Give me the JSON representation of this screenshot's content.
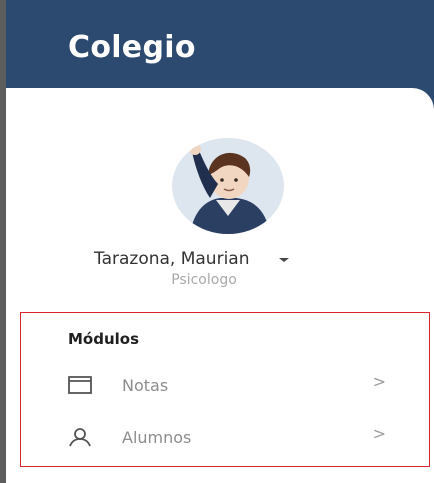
{
  "header": {
    "title": "Colegio"
  },
  "user": {
    "name": "Tarazona, Maurian",
    "role": "Psicologo"
  },
  "modules": {
    "title": "Módulos",
    "items": [
      {
        "label": "Notas",
        "icon": "calendar-icon",
        "chevron": ">"
      },
      {
        "label": "Alumnos",
        "icon": "user-icon",
        "chevron": ">"
      }
    ]
  },
  "colors": {
    "header": "#2c4a6f",
    "highlight_border": "#d9232d",
    "text_primary": "#333333",
    "text_secondary": "#a9a9a9"
  }
}
